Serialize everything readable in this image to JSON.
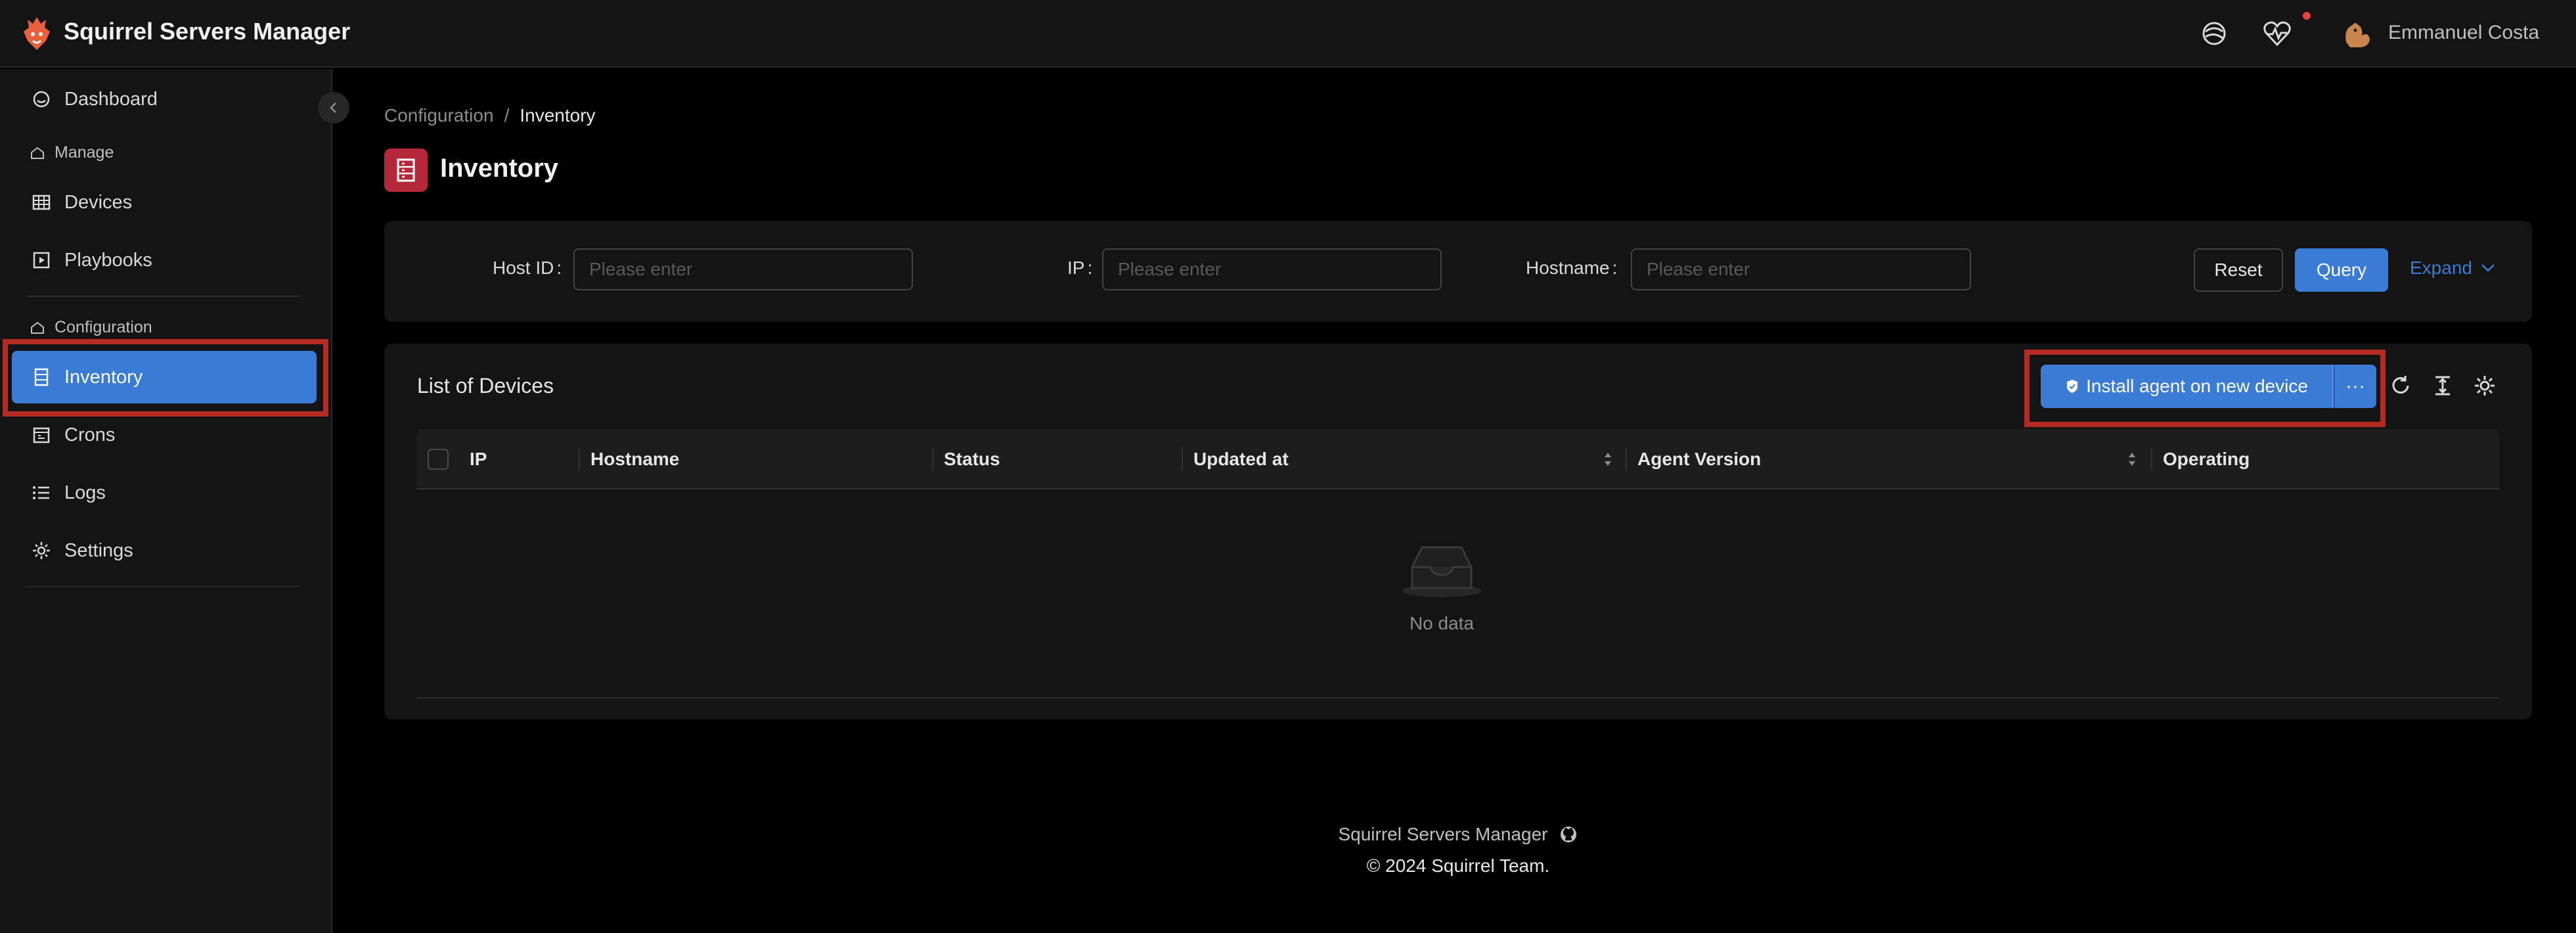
{
  "header": {
    "app_title": "Squirrel Servers Manager",
    "user_name": "Emmanuel Costa",
    "icons": [
      "logo-icon",
      "planet-icon",
      "heart-pulse-icon",
      "avatar-icon"
    ],
    "notification_color": "#e8423c"
  },
  "sidebar": {
    "items": [
      {
        "label": "Dashboard",
        "icon": "dashboard-icon"
      },
      {
        "label": "Devices",
        "icon": "table-icon"
      },
      {
        "label": "Playbooks",
        "icon": "play-square-icon"
      },
      {
        "label": "Inventory",
        "icon": "database-icon",
        "active": true
      },
      {
        "label": "Crons",
        "icon": "calendar-icon"
      },
      {
        "label": "Logs",
        "icon": "list-icon"
      },
      {
        "label": "Settings",
        "icon": "gear-icon"
      }
    ],
    "groups": [
      "Manage",
      "Configuration"
    ]
  },
  "breadcrumb": {
    "root": "Configuration",
    "separator": "/",
    "current": "Inventory"
  },
  "page": {
    "title": "Inventory",
    "icon_color": "#b5283a"
  },
  "search": {
    "host_id_label": "Host ID",
    "ip_label": "IP",
    "hostname_label": "Hostname",
    "placeholder": "Please enter",
    "reset_label": "Reset",
    "query_label": "Query",
    "expand_label": "Expand"
  },
  "table": {
    "title": "List of Devices",
    "install_label": "Install agent on new device",
    "more_label": "···",
    "columns": [
      "IP",
      "Hostname",
      "Status",
      "Updated at",
      "Agent Version",
      "Operating"
    ],
    "empty_text": "No data"
  },
  "footer": {
    "line1": "Squirrel Servers Manager",
    "line2": "© 2024 Squirrel Team."
  },
  "colors": {
    "accent": "#3a7bd5",
    "highlight": "#b52a22",
    "background": "#000000",
    "panel": "#141414"
  }
}
